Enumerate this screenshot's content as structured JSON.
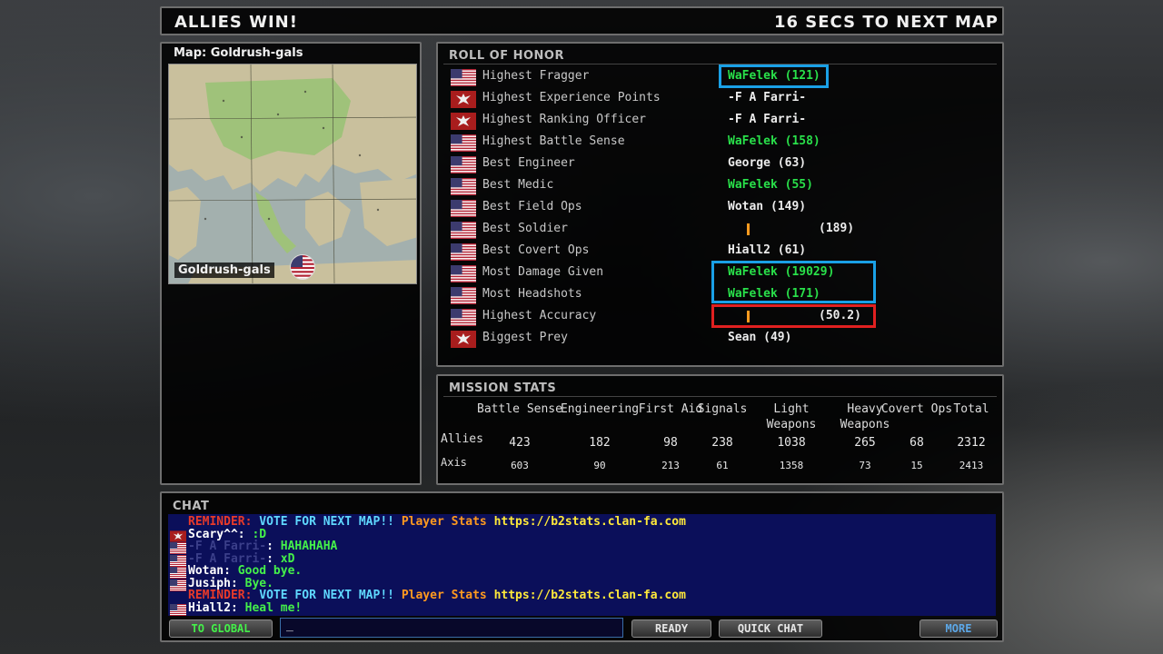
{
  "header": {
    "result": "ALLIES WIN!",
    "countdown": "16 SECS TO NEXT MAP"
  },
  "map": {
    "label": "Map: Goldrush-gals",
    "name": "Goldrush-gals"
  },
  "roll_of_honor": {
    "title": "ROLL OF HONOR",
    "rows": [
      {
        "flag": "us-flag-icon",
        "category": "Highest Fragger",
        "value": "WaFelek (121)",
        "color": "green"
      },
      {
        "flag": "axis-eagle-icon",
        "category": "Highest Experience Points",
        "value": "-F A Farri-",
        "color": "dim"
      },
      {
        "flag": "axis-eagle-icon",
        "category": "Highest Ranking Officer",
        "value": "-F A Farri-",
        "color": "dim"
      },
      {
        "flag": "us-flag-icon",
        "category": "Highest Battle Sense",
        "value": "WaFelek (158)",
        "color": "green"
      },
      {
        "flag": "us-flag-icon",
        "category": "Best Engineer",
        "value": "George (63)",
        "color": "white"
      },
      {
        "flag": "us-flag-icon",
        "category": "Best Medic",
        "value": "WaFelek (55)",
        "color": "green"
      },
      {
        "flag": "us-flag-icon",
        "category": "Best Field Ops",
        "value": "Wotan (149)",
        "color": "white"
      },
      {
        "flag": "us-flag-icon",
        "category": "Best Soldier",
        "value": "(189)",
        "color": "white"
      },
      {
        "flag": "us-flag-icon",
        "category": "Best Covert Ops",
        "value": "Hiall2 (61)",
        "color": "white"
      },
      {
        "flag": "us-flag-icon",
        "category": "Most Damage Given",
        "value": "WaFelek (19029)",
        "color": "green"
      },
      {
        "flag": "us-flag-icon",
        "category": "Most Headshots",
        "value": "WaFelek (171)",
        "color": "green"
      },
      {
        "flag": "us-flag-icon",
        "category": "Highest Accuracy",
        "value": "(50.2)",
        "color": "white"
      },
      {
        "flag": "axis-eagle-icon",
        "category": "Biggest Prey",
        "value": "Sean (49)",
        "color": "white"
      }
    ]
  },
  "mission_stats": {
    "title": "MISSION STATS",
    "columns": [
      "Battle Sense",
      "Engineering",
      "First Aid",
      "Signals",
      "Light Weapons",
      "Heavy Weapons",
      "Covert Ops",
      "Total"
    ],
    "rows": [
      {
        "team": "Allies",
        "values": [
          "423",
          "182",
          "98",
          "238",
          "1038",
          "265",
          "68",
          "2312"
        ]
      },
      {
        "team": "Axis",
        "values": [
          "603",
          "90",
          "213",
          "61",
          "1358",
          "73",
          "15",
          "2413"
        ]
      }
    ]
  },
  "chat": {
    "title": "CHAT",
    "lines": [
      {
        "flag": "",
        "parts": [
          [
            "REMINDER: ",
            "c-red"
          ],
          [
            "VOTE FOR NEXT MAP!! ",
            "c-cyan"
          ],
          [
            "Player Stats ",
            "c-orange"
          ],
          [
            "https://b2stats.clan-fa.com",
            "c-yellow"
          ]
        ]
      },
      {
        "flag": "axis-eagle-icon",
        "parts": [
          [
            "Scary^^",
            "c-white"
          ],
          [
            ": ",
            "c-white"
          ],
          [
            ":D",
            "c-green"
          ]
        ]
      },
      {
        "flag": "us-flag-icon",
        "parts": [
          [
            "-F A Farri-",
            "c-blur"
          ],
          [
            ": ",
            "c-white"
          ],
          [
            "HAHAHAHA",
            "c-green"
          ]
        ]
      },
      {
        "flag": "us-flag-icon",
        "parts": [
          [
            "-F A Farri-",
            "c-blur"
          ],
          [
            ": ",
            "c-white"
          ],
          [
            "xD",
            "c-green"
          ]
        ]
      },
      {
        "flag": "us-flag-icon",
        "parts": [
          [
            "Wotan",
            "c-white"
          ],
          [
            ": ",
            "c-white"
          ],
          [
            "Good bye.",
            "c-green"
          ]
        ]
      },
      {
        "flag": "us-flag-icon",
        "parts": [
          [
            "Jusiph",
            "c-white"
          ],
          [
            ": ",
            "c-white"
          ],
          [
            "Bye.",
            "c-green"
          ]
        ]
      },
      {
        "flag": "",
        "parts": [
          [
            "REMINDER: ",
            "c-red"
          ],
          [
            "VOTE FOR NEXT MAP!! ",
            "c-cyan"
          ],
          [
            "Player Stats ",
            "c-orange"
          ],
          [
            "https://b2stats.clan-fa.com",
            "c-yellow"
          ]
        ]
      },
      {
        "flag": "us-flag-icon",
        "parts": [
          [
            "Hiall2",
            "c-white"
          ],
          [
            ": ",
            "c-white"
          ],
          [
            "Heal me!",
            "c-green"
          ]
        ]
      }
    ],
    "input_value": "_",
    "buttons": {
      "to_global": "TO GLOBAL",
      "ready": "READY",
      "quick_chat": "QUICK CHAT",
      "more": "MORE"
    }
  }
}
